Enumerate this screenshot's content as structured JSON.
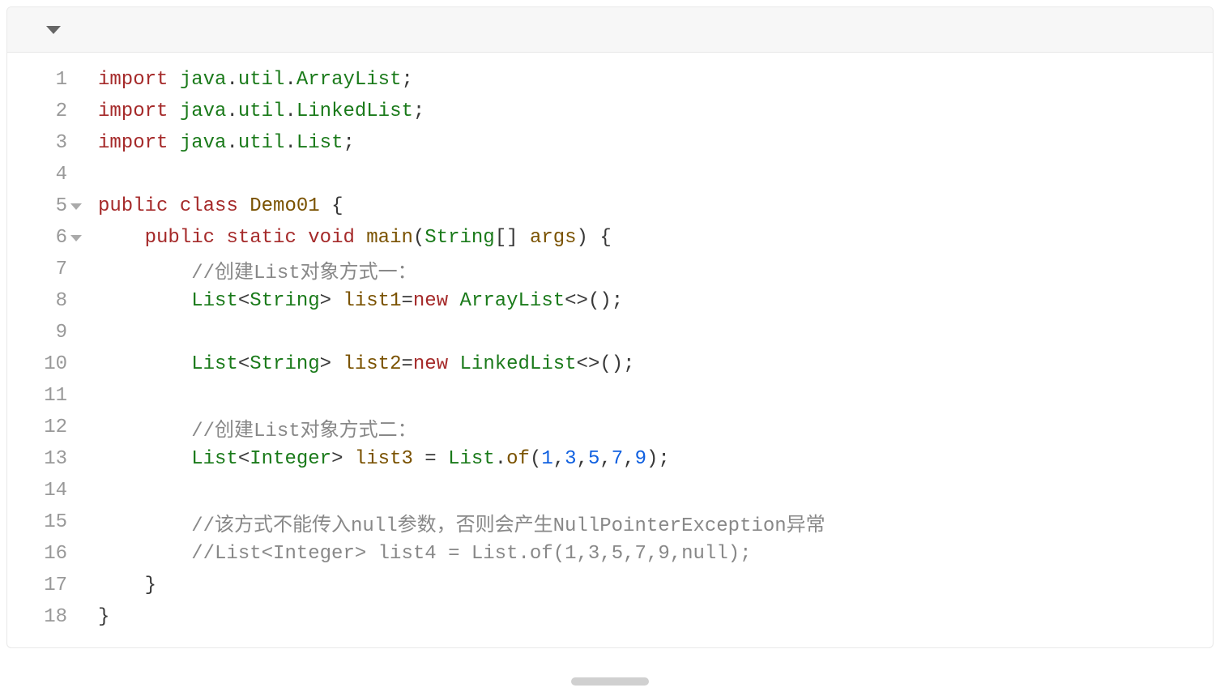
{
  "toolbar": {
    "dropdown_name": "language-dropdown"
  },
  "lines": [
    {
      "num": "1",
      "fold": false,
      "tokens": [
        [
          "kw",
          "import"
        ],
        [
          "punct",
          " "
        ],
        [
          "type",
          "java"
        ],
        [
          "punct",
          "."
        ],
        [
          "type",
          "util"
        ],
        [
          "punct",
          "."
        ],
        [
          "type",
          "ArrayList"
        ],
        [
          "punct",
          ";"
        ]
      ]
    },
    {
      "num": "2",
      "fold": false,
      "tokens": [
        [
          "kw",
          "import"
        ],
        [
          "punct",
          " "
        ],
        [
          "type",
          "java"
        ],
        [
          "punct",
          "."
        ],
        [
          "type",
          "util"
        ],
        [
          "punct",
          "."
        ],
        [
          "type",
          "LinkedList"
        ],
        [
          "punct",
          ";"
        ]
      ]
    },
    {
      "num": "3",
      "fold": false,
      "tokens": [
        [
          "kw",
          "import"
        ],
        [
          "punct",
          " "
        ],
        [
          "type",
          "java"
        ],
        [
          "punct",
          "."
        ],
        [
          "type",
          "util"
        ],
        [
          "punct",
          "."
        ],
        [
          "type",
          "List"
        ],
        [
          "punct",
          ";"
        ]
      ]
    },
    {
      "num": "4",
      "fold": false,
      "tokens": []
    },
    {
      "num": "5",
      "fold": true,
      "tokens": [
        [
          "kw",
          "public"
        ],
        [
          "punct",
          " "
        ],
        [
          "kw",
          "class"
        ],
        [
          "punct",
          " "
        ],
        [
          "ident",
          "Demo01"
        ],
        [
          "punct",
          " {"
        ]
      ]
    },
    {
      "num": "6",
      "fold": true,
      "tokens": [
        [
          "punct",
          "    "
        ],
        [
          "kw",
          "public"
        ],
        [
          "punct",
          " "
        ],
        [
          "kw",
          "static"
        ],
        [
          "punct",
          " "
        ],
        [
          "kw",
          "void"
        ],
        [
          "punct",
          " "
        ],
        [
          "ident",
          "main"
        ],
        [
          "punct",
          "("
        ],
        [
          "type",
          "String"
        ],
        [
          "punct",
          "[] "
        ],
        [
          "ident",
          "args"
        ],
        [
          "punct",
          ") {"
        ]
      ]
    },
    {
      "num": "7",
      "fold": false,
      "tokens": [
        [
          "punct",
          "        "
        ],
        [
          "comment",
          "//创建List对象方式一："
        ]
      ]
    },
    {
      "num": "8",
      "fold": false,
      "tokens": [
        [
          "punct",
          "        "
        ],
        [
          "type",
          "List"
        ],
        [
          "punct",
          "<"
        ],
        [
          "type",
          "String"
        ],
        [
          "punct",
          "> "
        ],
        [
          "ident",
          "list1"
        ],
        [
          "punct",
          "="
        ],
        [
          "kw",
          "new"
        ],
        [
          "punct",
          " "
        ],
        [
          "type",
          "ArrayList"
        ],
        [
          "punct",
          "<>();"
        ]
      ]
    },
    {
      "num": "9",
      "fold": false,
      "tokens": []
    },
    {
      "num": "10",
      "fold": false,
      "tokens": [
        [
          "punct",
          "        "
        ],
        [
          "type",
          "List"
        ],
        [
          "punct",
          "<"
        ],
        [
          "type",
          "String"
        ],
        [
          "punct",
          "> "
        ],
        [
          "ident",
          "list2"
        ],
        [
          "punct",
          "="
        ],
        [
          "kw",
          "new"
        ],
        [
          "punct",
          " "
        ],
        [
          "type",
          "LinkedList"
        ],
        [
          "punct",
          "<>();"
        ]
      ]
    },
    {
      "num": "11",
      "fold": false,
      "tokens": []
    },
    {
      "num": "12",
      "fold": false,
      "tokens": [
        [
          "punct",
          "        "
        ],
        [
          "comment",
          "//创建List对象方式二："
        ]
      ]
    },
    {
      "num": "13",
      "fold": false,
      "tokens": [
        [
          "punct",
          "        "
        ],
        [
          "type",
          "List"
        ],
        [
          "punct",
          "<"
        ],
        [
          "type",
          "Integer"
        ],
        [
          "punct",
          "> "
        ],
        [
          "ident",
          "list3"
        ],
        [
          "punct",
          " = "
        ],
        [
          "type",
          "List"
        ],
        [
          "punct",
          "."
        ],
        [
          "ident",
          "of"
        ],
        [
          "punct",
          "("
        ],
        [
          "num",
          "1"
        ],
        [
          "punct",
          ","
        ],
        [
          "num",
          "3"
        ],
        [
          "punct",
          ","
        ],
        [
          "num",
          "5"
        ],
        [
          "punct",
          ","
        ],
        [
          "num",
          "7"
        ],
        [
          "punct",
          ","
        ],
        [
          "num",
          "9"
        ],
        [
          "punct",
          ");"
        ]
      ]
    },
    {
      "num": "14",
      "fold": false,
      "tokens": []
    },
    {
      "num": "15",
      "fold": false,
      "tokens": [
        [
          "punct",
          "        "
        ],
        [
          "comment",
          "//该方式不能传入null参数，否则会产生NullPointerException异常"
        ]
      ]
    },
    {
      "num": "16",
      "fold": false,
      "tokens": [
        [
          "punct",
          "        "
        ],
        [
          "comment",
          "//List<Integer> list4 = List.of(1,3,5,7,9,null);"
        ]
      ]
    },
    {
      "num": "17",
      "fold": false,
      "tokens": [
        [
          "punct",
          "    }"
        ]
      ]
    },
    {
      "num": "18",
      "fold": false,
      "tokens": [
        [
          "punct",
          "}"
        ]
      ]
    }
  ]
}
